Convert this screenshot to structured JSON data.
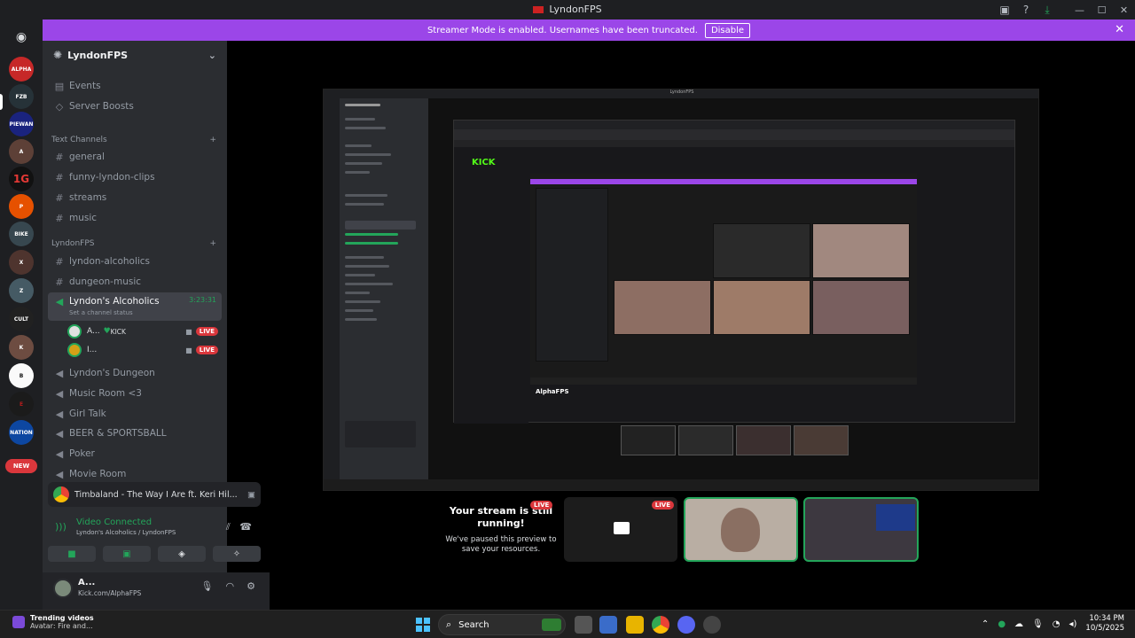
{
  "window": {
    "title": "LyndonFPS"
  },
  "banner": {
    "text": "Streamer Mode is enabled. Usernames have been truncated.",
    "disable_label": "Disable"
  },
  "rail": {
    "servers": [
      "ALPHA",
      "FZB",
      "PIEWAN",
      "A",
      "1G",
      "P",
      "BIKE",
      "X",
      "Z",
      "CULT",
      "K",
      "B",
      "E",
      "NATION",
      "R"
    ],
    "new_badge": "NEW"
  },
  "sidebar": {
    "guild_name": "LyndonFPS",
    "top_items": [
      "Events",
      "Server Boosts"
    ],
    "text_category": "Text Channels",
    "text_channels": [
      "general",
      "funny-lyndon-clips",
      "streams",
      "music"
    ],
    "lyndon_category": "LyndonFPS",
    "lyndon_channels": [
      "lyndon-alcoholics",
      "dungeon-music"
    ],
    "active_voice": {
      "name": "Lyndon's Alcoholics",
      "status": "Set a channel status",
      "timer": "3:23:31"
    },
    "voice_users": [
      {
        "name": "A...",
        "tag": "KICK",
        "live": "LIVE"
      },
      {
        "name": "I...",
        "tag": "",
        "live": "LIVE"
      }
    ],
    "voice_channels": [
      "Lyndon's Dungeon",
      "Music Room <3",
      "Girl Talk",
      "BEER & SPORTSBALL",
      "Poker",
      "Movie Room"
    ]
  },
  "activity": {
    "text": "Timbaland - The Way I Are ft. Keri Hil..."
  },
  "voice_panel": {
    "status": "Video Connected",
    "channel": "Lyndon's Alcoholics / LyndonFPS"
  },
  "user": {
    "name": "A...",
    "status": "Kick.com/AlphaFPS"
  },
  "preview": {
    "paused_title": "Your stream is still running!",
    "paused_sub": "We've paused this preview to save your resources.",
    "live_label": "LIVE"
  },
  "inner": {
    "title": "LyndonFPS",
    "kick": "KICK",
    "streamer": "AlphaFPS"
  },
  "taskbar": {
    "news_title": "Trending videos",
    "news_sub": "Avatar: Fire and...",
    "search": "Search",
    "time": "10:34 PM",
    "date": "10/5/2025"
  },
  "colors": {
    "accent_green": "#23a55a",
    "streamer_purple": "#9b46e8",
    "live_red": "#da373c",
    "kick_green": "#53fc18"
  }
}
